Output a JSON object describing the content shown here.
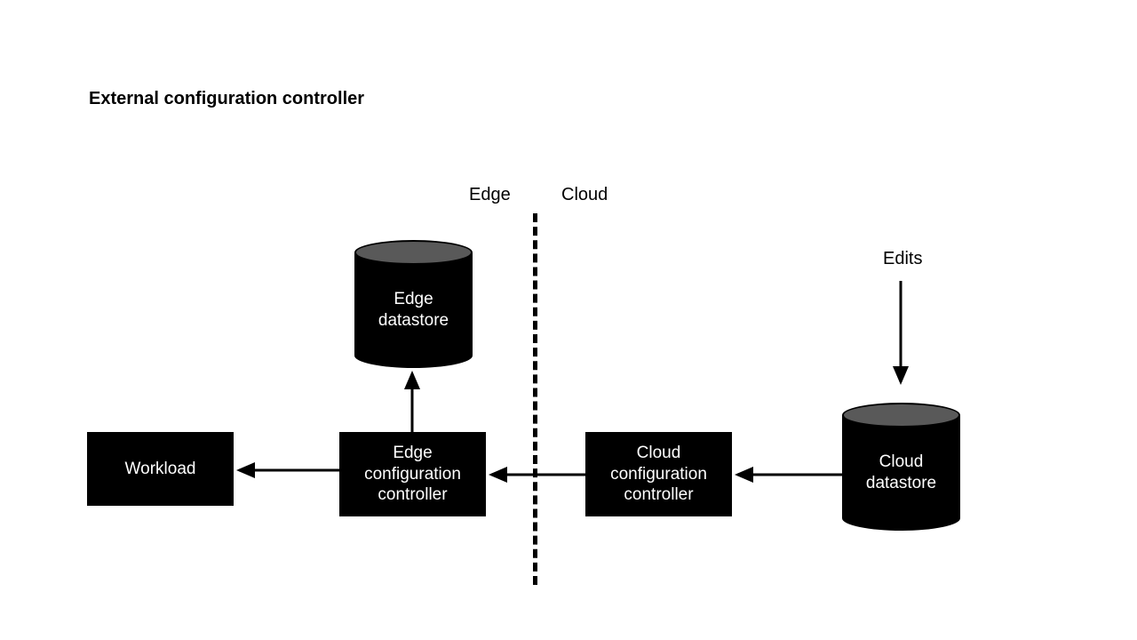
{
  "title": "External configuration controller",
  "region_labels": {
    "edge": "Edge",
    "cloud": "Cloud"
  },
  "edits_label": "Edits",
  "nodes": {
    "workload": "Workload",
    "edge_controller": "Edge configuration controller",
    "cloud_controller": "Cloud configuration controller",
    "edge_datastore": "Edge datastore",
    "cloud_datastore": "Cloud datastore"
  }
}
